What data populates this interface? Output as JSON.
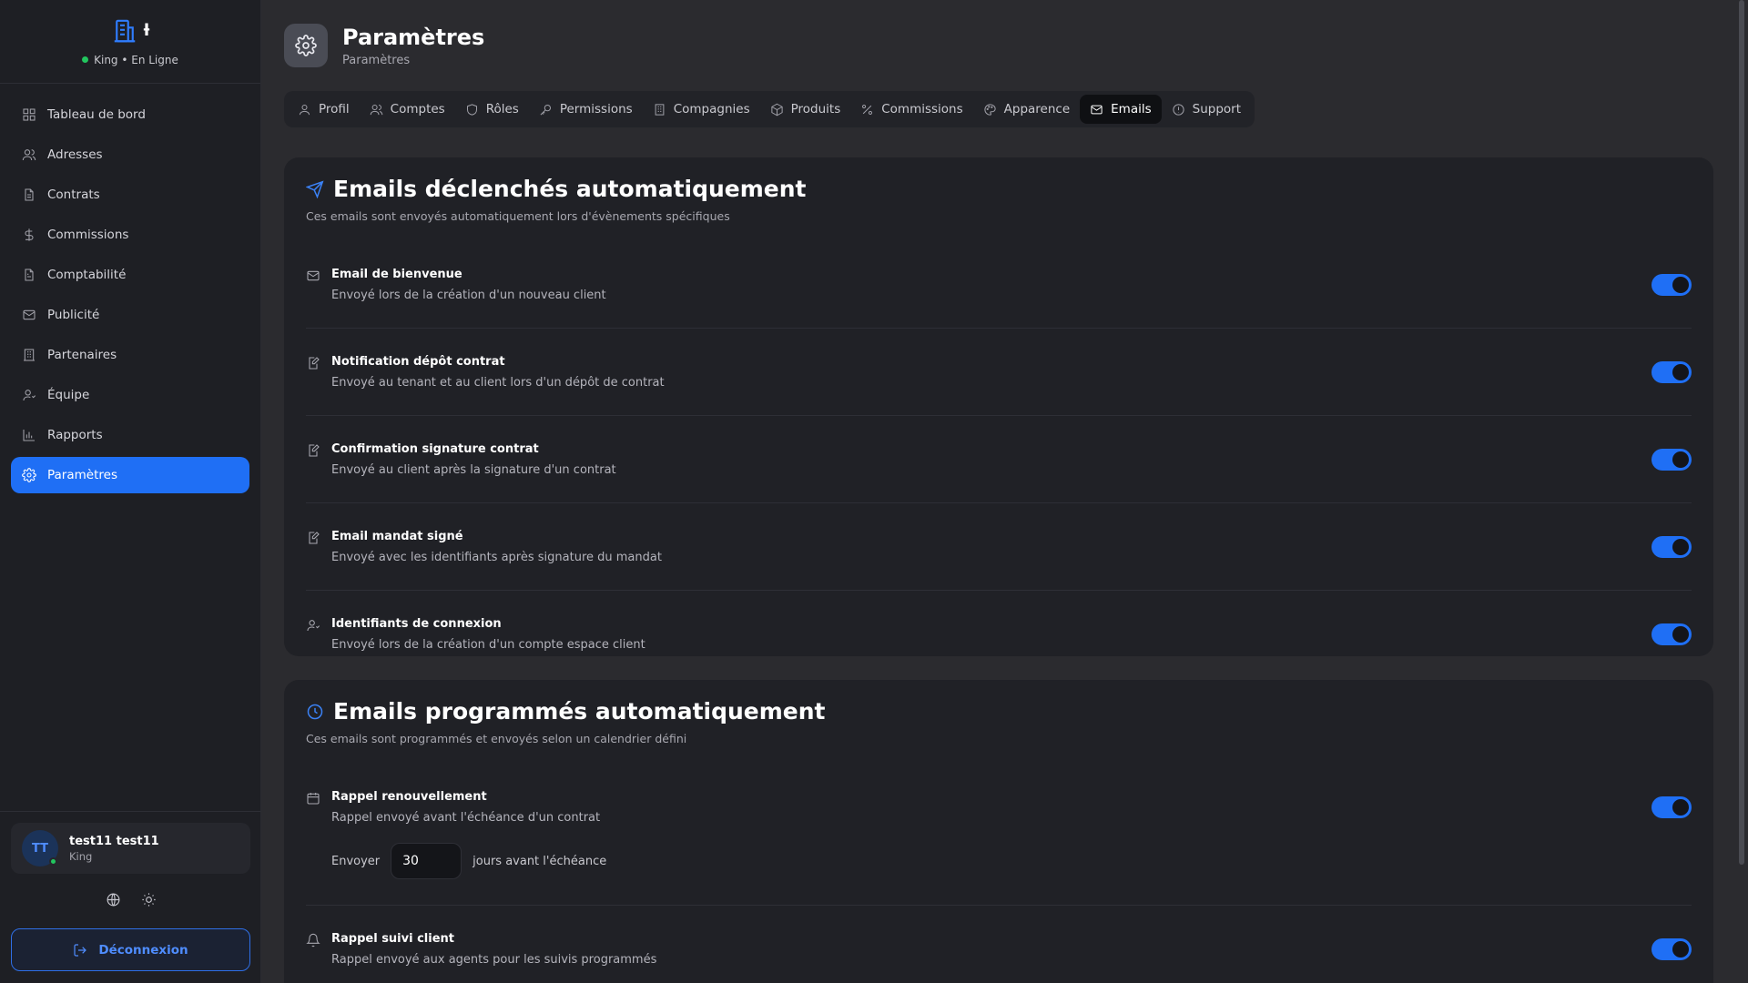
{
  "brand": {
    "status": "King • En Ligne",
    "mark": "ƚ"
  },
  "sidebar": {
    "items": [
      {
        "label": "Tableau de bord",
        "icon": "dashboard-icon"
      },
      {
        "label": "Adresses",
        "icon": "users-icon"
      },
      {
        "label": "Contrats",
        "icon": "document-icon"
      },
      {
        "label": "Commissions",
        "icon": "dollar-icon"
      },
      {
        "label": "Comptabilité",
        "icon": "ledger-icon"
      },
      {
        "label": "Publicité",
        "icon": "mail-icon"
      },
      {
        "label": "Partenaires",
        "icon": "building-icon"
      },
      {
        "label": "Équipe",
        "icon": "team-icon"
      },
      {
        "label": "Rapports",
        "icon": "chart-icon"
      },
      {
        "label": "Paramètres",
        "icon": "gear-icon",
        "active": true
      }
    ]
  },
  "user": {
    "initials": "TT",
    "name": "test11 test11",
    "role": "King"
  },
  "logout_label": "Déconnexion",
  "header": {
    "title": "Paramètres",
    "subtitle": "Paramètres"
  },
  "tabs": [
    {
      "label": "Profil"
    },
    {
      "label": "Comptes"
    },
    {
      "label": "Rôles"
    },
    {
      "label": "Permissions"
    },
    {
      "label": "Compagnies"
    },
    {
      "label": "Produits"
    },
    {
      "label": "Commissions"
    },
    {
      "label": "Apparence"
    },
    {
      "label": "Emails",
      "active": true
    },
    {
      "label": "Support"
    }
  ],
  "triggered": {
    "title": "Emails déclenchés automatiquement",
    "description": "Ces emails sont envoyés automatiquement lors d'évènements spécifiques",
    "rows": [
      {
        "title": "Email de bienvenue",
        "desc": "Envoyé lors de la création d'un nouveau client",
        "enabled": true
      },
      {
        "title": "Notification dépôt contrat",
        "desc": "Envoyé au tenant et au client lors d'un dépôt de contrat",
        "enabled": true
      },
      {
        "title": "Confirmation signature contrat",
        "desc": "Envoyé au client après la signature d'un contrat",
        "enabled": true
      },
      {
        "title": "Email mandat signé",
        "desc": "Envoyé avec les identifiants après signature du mandat",
        "enabled": true
      },
      {
        "title": "Identifiants de connexion",
        "desc": "Envoyé lors de la création d'un compte espace client",
        "enabled": true
      }
    ]
  },
  "scheduled": {
    "title": "Emails programmés automatiquement",
    "description": "Ces emails sont programmés et envoyés selon un calendrier défini",
    "rows": [
      {
        "title": "Rappel renouvellement",
        "desc": "Rappel envoyé avant l'échéance d'un contrat",
        "enabled": true,
        "send_prefix": "Envoyer",
        "days_value": "30",
        "send_suffix": "jours avant l'échéance"
      },
      {
        "title": "Rappel suivi client",
        "desc": "Rappel envoyé aux agents pour les suivis programmés",
        "enabled": true
      }
    ]
  },
  "colors": {
    "accent": "#1f6ff5",
    "online": "#22c55e"
  }
}
